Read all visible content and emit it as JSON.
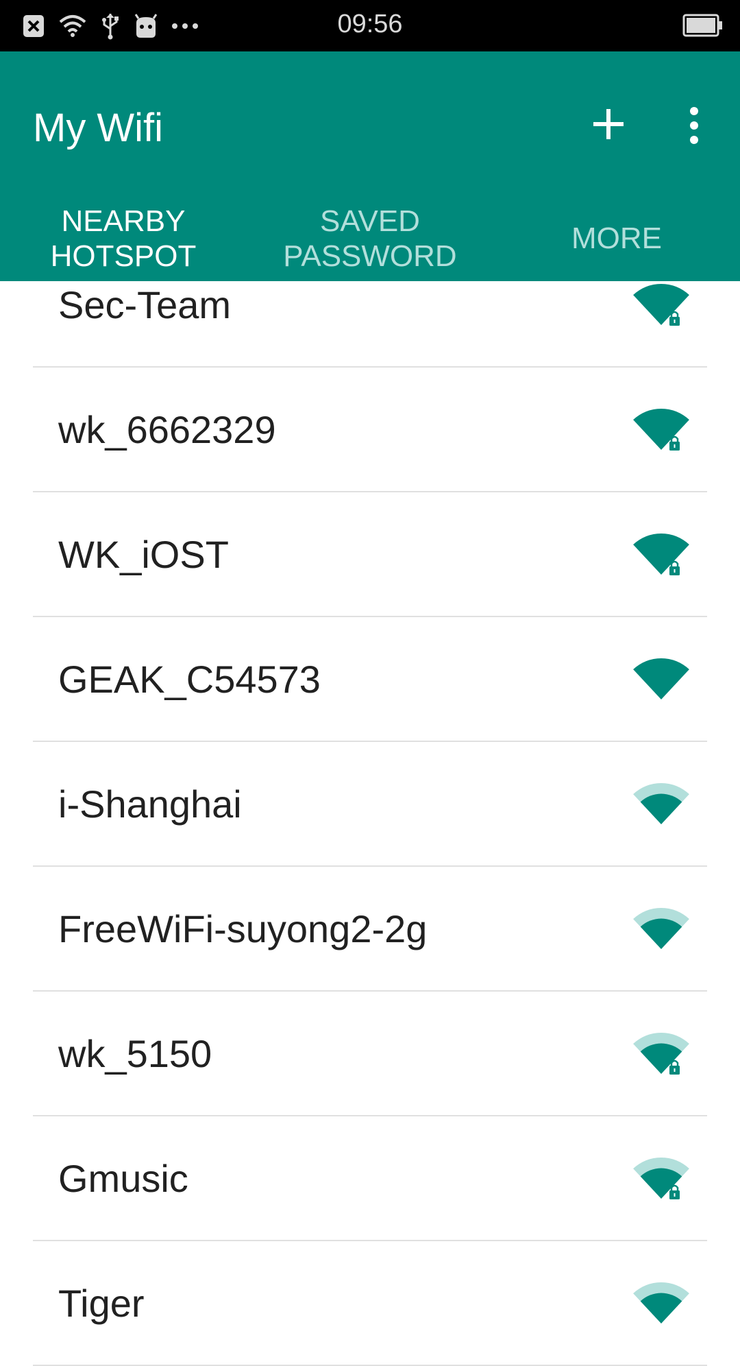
{
  "status_bar": {
    "time": "09:56",
    "icons": [
      "notification-close-icon",
      "wifi-icon",
      "usb-icon",
      "android-icon",
      "more-dots-icon"
    ],
    "battery": "battery-icon"
  },
  "app_bar": {
    "title": "My Wifi",
    "add_icon": "plus-icon",
    "menu_icon": "overflow-menu-icon",
    "background": "#00897B"
  },
  "tabs": [
    {
      "label": "NEARBY\nHOTSPOT",
      "active": true
    },
    {
      "label": "SAVED\nPASSWORD",
      "active": false
    },
    {
      "label": "MORE",
      "active": false
    }
  ],
  "networks": [
    {
      "name": "Sec-Team",
      "signal": 4,
      "locked": true
    },
    {
      "name": "wk_6662329",
      "signal": 4,
      "locked": true
    },
    {
      "name": "WK_iOST",
      "signal": 4,
      "locked": true
    },
    {
      "name": "GEAK_C54573",
      "signal": 4,
      "locked": false
    },
    {
      "name": "i-Shanghai",
      "signal": 3,
      "locked": false
    },
    {
      "name": "FreeWiFi-suyong2-2g",
      "signal": 3,
      "locked": false
    },
    {
      "name": "wk_5150",
      "signal": 3,
      "locked": true
    },
    {
      "name": "Gmusic",
      "signal": 3,
      "locked": true
    },
    {
      "name": "Tiger",
      "signal": 3,
      "locked": false
    }
  ],
  "colors": {
    "accent": "#00897B",
    "signal_strong": "#00897B",
    "signal_weak": "#B2DFDB"
  }
}
